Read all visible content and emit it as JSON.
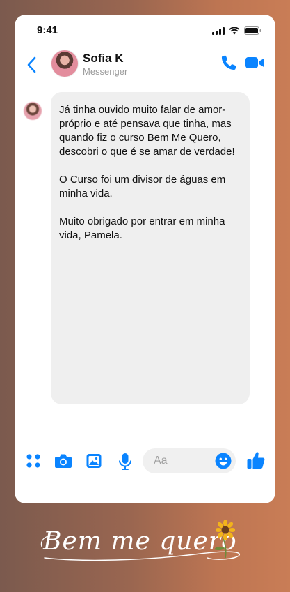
{
  "status_bar": {
    "time": "9:41"
  },
  "header": {
    "name": "Sofia K",
    "subtitle": "Messenger"
  },
  "message": {
    "paragraphs": [
      "Já tinha ouvido muito falar de amor-próprio e até pensava que tinha, mas quando fiz o curso Bem Me Quero, descobri o que é se amar de verdade!",
      "O Curso foi um divisor de águas em minha vida.",
      "Muito obrigado por entrar em minha vida, Pamela."
    ]
  },
  "composer": {
    "placeholder": "Aa"
  },
  "brand": {
    "logo_text": "Bem me quero"
  },
  "colors": {
    "messenger_blue": "#0a84ff",
    "bubble_gray": "#efefef",
    "gradient_left": "#7b5a4e",
    "gradient_right": "#c97d56"
  },
  "icons": [
    "back-chevron-icon",
    "phone-icon",
    "video-camera-icon",
    "apps-grid-icon",
    "camera-icon",
    "gallery-icon",
    "microphone-icon",
    "emoji-icon",
    "thumbs-up-icon",
    "sunflower-icon"
  ]
}
